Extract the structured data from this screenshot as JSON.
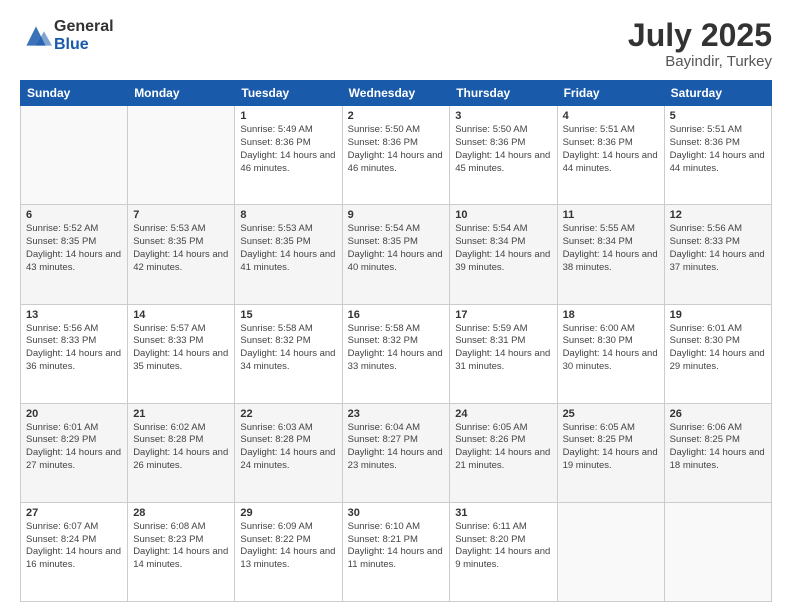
{
  "logo": {
    "general": "General",
    "blue": "Blue"
  },
  "title": "July 2025",
  "location": "Bayindir, Turkey",
  "days_of_week": [
    "Sunday",
    "Monday",
    "Tuesday",
    "Wednesday",
    "Thursday",
    "Friday",
    "Saturday"
  ],
  "weeks": [
    [
      {
        "day": "",
        "sunrise": "",
        "sunset": "",
        "daylight": ""
      },
      {
        "day": "",
        "sunrise": "",
        "sunset": "",
        "daylight": ""
      },
      {
        "day": "1",
        "sunrise": "Sunrise: 5:49 AM",
        "sunset": "Sunset: 8:36 PM",
        "daylight": "Daylight: 14 hours and 46 minutes."
      },
      {
        "day": "2",
        "sunrise": "Sunrise: 5:50 AM",
        "sunset": "Sunset: 8:36 PM",
        "daylight": "Daylight: 14 hours and 46 minutes."
      },
      {
        "day": "3",
        "sunrise": "Sunrise: 5:50 AM",
        "sunset": "Sunset: 8:36 PM",
        "daylight": "Daylight: 14 hours and 45 minutes."
      },
      {
        "day": "4",
        "sunrise": "Sunrise: 5:51 AM",
        "sunset": "Sunset: 8:36 PM",
        "daylight": "Daylight: 14 hours and 44 minutes."
      },
      {
        "day": "5",
        "sunrise": "Sunrise: 5:51 AM",
        "sunset": "Sunset: 8:36 PM",
        "daylight": "Daylight: 14 hours and 44 minutes."
      }
    ],
    [
      {
        "day": "6",
        "sunrise": "Sunrise: 5:52 AM",
        "sunset": "Sunset: 8:35 PM",
        "daylight": "Daylight: 14 hours and 43 minutes."
      },
      {
        "day": "7",
        "sunrise": "Sunrise: 5:53 AM",
        "sunset": "Sunset: 8:35 PM",
        "daylight": "Daylight: 14 hours and 42 minutes."
      },
      {
        "day": "8",
        "sunrise": "Sunrise: 5:53 AM",
        "sunset": "Sunset: 8:35 PM",
        "daylight": "Daylight: 14 hours and 41 minutes."
      },
      {
        "day": "9",
        "sunrise": "Sunrise: 5:54 AM",
        "sunset": "Sunset: 8:35 PM",
        "daylight": "Daylight: 14 hours and 40 minutes."
      },
      {
        "day": "10",
        "sunrise": "Sunrise: 5:54 AM",
        "sunset": "Sunset: 8:34 PM",
        "daylight": "Daylight: 14 hours and 39 minutes."
      },
      {
        "day": "11",
        "sunrise": "Sunrise: 5:55 AM",
        "sunset": "Sunset: 8:34 PM",
        "daylight": "Daylight: 14 hours and 38 minutes."
      },
      {
        "day": "12",
        "sunrise": "Sunrise: 5:56 AM",
        "sunset": "Sunset: 8:33 PM",
        "daylight": "Daylight: 14 hours and 37 minutes."
      }
    ],
    [
      {
        "day": "13",
        "sunrise": "Sunrise: 5:56 AM",
        "sunset": "Sunset: 8:33 PM",
        "daylight": "Daylight: 14 hours and 36 minutes."
      },
      {
        "day": "14",
        "sunrise": "Sunrise: 5:57 AM",
        "sunset": "Sunset: 8:33 PM",
        "daylight": "Daylight: 14 hours and 35 minutes."
      },
      {
        "day": "15",
        "sunrise": "Sunrise: 5:58 AM",
        "sunset": "Sunset: 8:32 PM",
        "daylight": "Daylight: 14 hours and 34 minutes."
      },
      {
        "day": "16",
        "sunrise": "Sunrise: 5:58 AM",
        "sunset": "Sunset: 8:32 PM",
        "daylight": "Daylight: 14 hours and 33 minutes."
      },
      {
        "day": "17",
        "sunrise": "Sunrise: 5:59 AM",
        "sunset": "Sunset: 8:31 PM",
        "daylight": "Daylight: 14 hours and 31 minutes."
      },
      {
        "day": "18",
        "sunrise": "Sunrise: 6:00 AM",
        "sunset": "Sunset: 8:30 PM",
        "daylight": "Daylight: 14 hours and 30 minutes."
      },
      {
        "day": "19",
        "sunrise": "Sunrise: 6:01 AM",
        "sunset": "Sunset: 8:30 PM",
        "daylight": "Daylight: 14 hours and 29 minutes."
      }
    ],
    [
      {
        "day": "20",
        "sunrise": "Sunrise: 6:01 AM",
        "sunset": "Sunset: 8:29 PM",
        "daylight": "Daylight: 14 hours and 27 minutes."
      },
      {
        "day": "21",
        "sunrise": "Sunrise: 6:02 AM",
        "sunset": "Sunset: 8:28 PM",
        "daylight": "Daylight: 14 hours and 26 minutes."
      },
      {
        "day": "22",
        "sunrise": "Sunrise: 6:03 AM",
        "sunset": "Sunset: 8:28 PM",
        "daylight": "Daylight: 14 hours and 24 minutes."
      },
      {
        "day": "23",
        "sunrise": "Sunrise: 6:04 AM",
        "sunset": "Sunset: 8:27 PM",
        "daylight": "Daylight: 14 hours and 23 minutes."
      },
      {
        "day": "24",
        "sunrise": "Sunrise: 6:05 AM",
        "sunset": "Sunset: 8:26 PM",
        "daylight": "Daylight: 14 hours and 21 minutes."
      },
      {
        "day": "25",
        "sunrise": "Sunrise: 6:05 AM",
        "sunset": "Sunset: 8:25 PM",
        "daylight": "Daylight: 14 hours and 19 minutes."
      },
      {
        "day": "26",
        "sunrise": "Sunrise: 6:06 AM",
        "sunset": "Sunset: 8:25 PM",
        "daylight": "Daylight: 14 hours and 18 minutes."
      }
    ],
    [
      {
        "day": "27",
        "sunrise": "Sunrise: 6:07 AM",
        "sunset": "Sunset: 8:24 PM",
        "daylight": "Daylight: 14 hours and 16 minutes."
      },
      {
        "day": "28",
        "sunrise": "Sunrise: 6:08 AM",
        "sunset": "Sunset: 8:23 PM",
        "daylight": "Daylight: 14 hours and 14 minutes."
      },
      {
        "day": "29",
        "sunrise": "Sunrise: 6:09 AM",
        "sunset": "Sunset: 8:22 PM",
        "daylight": "Daylight: 14 hours and 13 minutes."
      },
      {
        "day": "30",
        "sunrise": "Sunrise: 6:10 AM",
        "sunset": "Sunset: 8:21 PM",
        "daylight": "Daylight: 14 hours and 11 minutes."
      },
      {
        "day": "31",
        "sunrise": "Sunrise: 6:11 AM",
        "sunset": "Sunset: 8:20 PM",
        "daylight": "Daylight: 14 hours and 9 minutes."
      },
      {
        "day": "",
        "sunrise": "",
        "sunset": "",
        "daylight": ""
      },
      {
        "day": "",
        "sunrise": "",
        "sunset": "",
        "daylight": ""
      }
    ]
  ]
}
